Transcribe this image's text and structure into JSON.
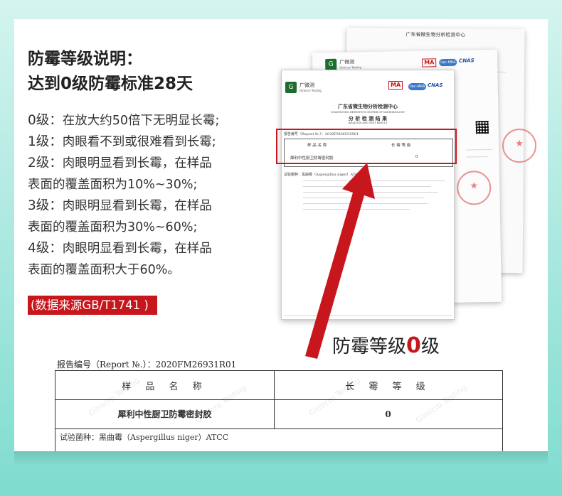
{
  "heading": {
    "line1": "防霉等级说明：",
    "line2": "达到0级防霉标准28天"
  },
  "levels": [
    {
      "key": "0级：",
      "text": "在放大约50倍下无明显长霉;"
    },
    {
      "key": "1级：",
      "text": "肉眼看不到或很难看到长霉;"
    },
    {
      "key": "2级：",
      "text": "肉眼明显看到长霉，在样品",
      "cont": "表面的覆盖面积为10%~30%;"
    },
    {
      "key": "3级：",
      "text": "肉眼明显看到长霉，在样品",
      "cont": "表面的覆盖面积为30%~60%;"
    },
    {
      "key": "4级：",
      "text": "肉眼明显看到长霉，在样品",
      "cont": "表面的覆盖面积大于60%。"
    }
  ],
  "source_label": "(数据来源GB/T1741 )",
  "grade": {
    "prefix": "防霉等级",
    "value": "0",
    "suffix": "级"
  },
  "report": {
    "brand": "广微测",
    "brand_en": "Gimicro Testing",
    "org": "广东省微生物分析检测中心",
    "org_en": "GUANGDONG DETECTION CENTER OF MICROBIOLOGY",
    "doc_title": "分 析 检 测 结 果",
    "doc_title_en": "ANALYSIS AND TEST RESULT",
    "cma": "MA",
    "ilac": "ilac-MRA",
    "cnas": "CNAS",
    "report_no_small": "报告编号（Report №.）：2020FM26931R01",
    "report_no": "报告编号（Report №.）：2020FM26931R01",
    "col_sample": "样 品 名 称",
    "col_result": "长 霉 等 级",
    "sample_name": "犀利中性厨卫防霉密封胶",
    "result": "0",
    "partial_row": "试验菌种：黑曲霉（Aspergillus niger）ATCC"
  },
  "colors": {
    "accent_red": "#c8161d",
    "teal_bg": "#7fdccf",
    "logo_green": "#1d6e2e"
  }
}
